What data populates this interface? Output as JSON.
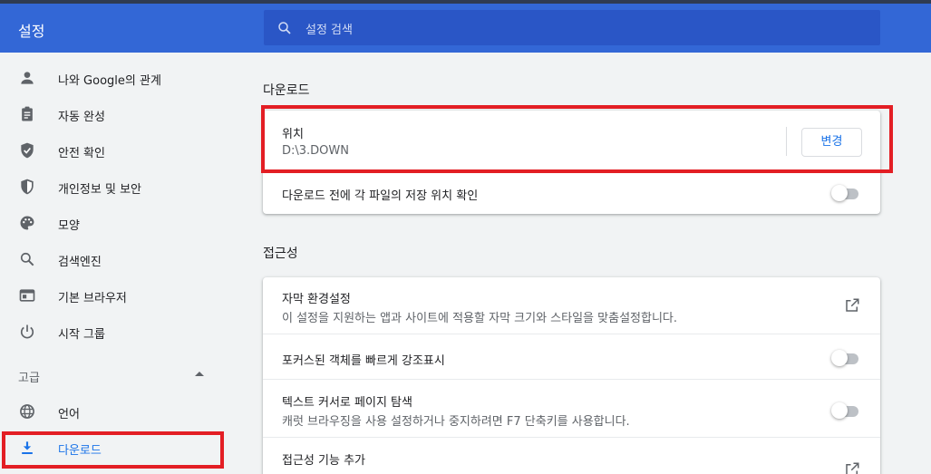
{
  "header": {
    "title": "설정",
    "search_placeholder": "설정 검색"
  },
  "sidebar": {
    "items": [
      {
        "label": "나와 Google의 관계",
        "icon": "person-icon"
      },
      {
        "label": "자동 완성",
        "icon": "clipboard-icon"
      },
      {
        "label": "안전 확인",
        "icon": "shield-check-icon"
      },
      {
        "label": "개인정보 및 보안",
        "icon": "shield-half-icon"
      },
      {
        "label": "모양",
        "icon": "palette-icon"
      },
      {
        "label": "검색엔진",
        "icon": "search-icon"
      },
      {
        "label": "기본 브라우저",
        "icon": "browser-window-icon"
      },
      {
        "label": "시작 그룹",
        "icon": "power-icon"
      }
    ],
    "advanced_label": "고급",
    "advanced_items": [
      {
        "label": "언어",
        "icon": "globe-icon"
      },
      {
        "label": "다운로드",
        "icon": "download-icon",
        "active": true
      }
    ]
  },
  "downloads": {
    "section_title": "다운로드",
    "location_title": "위치",
    "location_path": "D:\\3.DOWN",
    "change_button": "변경",
    "ask_where": "다운로드 전에 각 파일의 저장 위치 확인",
    "ask_where_enabled": false
  },
  "accessibility": {
    "section_title": "접근성",
    "captions_title": "자막 환경설정",
    "captions_sub": "이 설정을 지원하는 앱과 사이트에 적용할 자막 크기와 스타일을 맞춤설정합니다.",
    "focus_highlight": "포커스된 객체를 빠르게 강조표시",
    "focus_highlight_enabled": false,
    "caret_title": "텍스트 커서로 페이지 탐색",
    "caret_sub": "캐럿 브라우징을 사용 설정하거나 중지하려면 F7 단축키를 사용합니다.",
    "caret_enabled": false,
    "add_features": "접근성 기능 추가"
  },
  "colors": {
    "header_bg": "#3367d6",
    "accent": "#1a73e8",
    "highlight": "#e31e24"
  }
}
